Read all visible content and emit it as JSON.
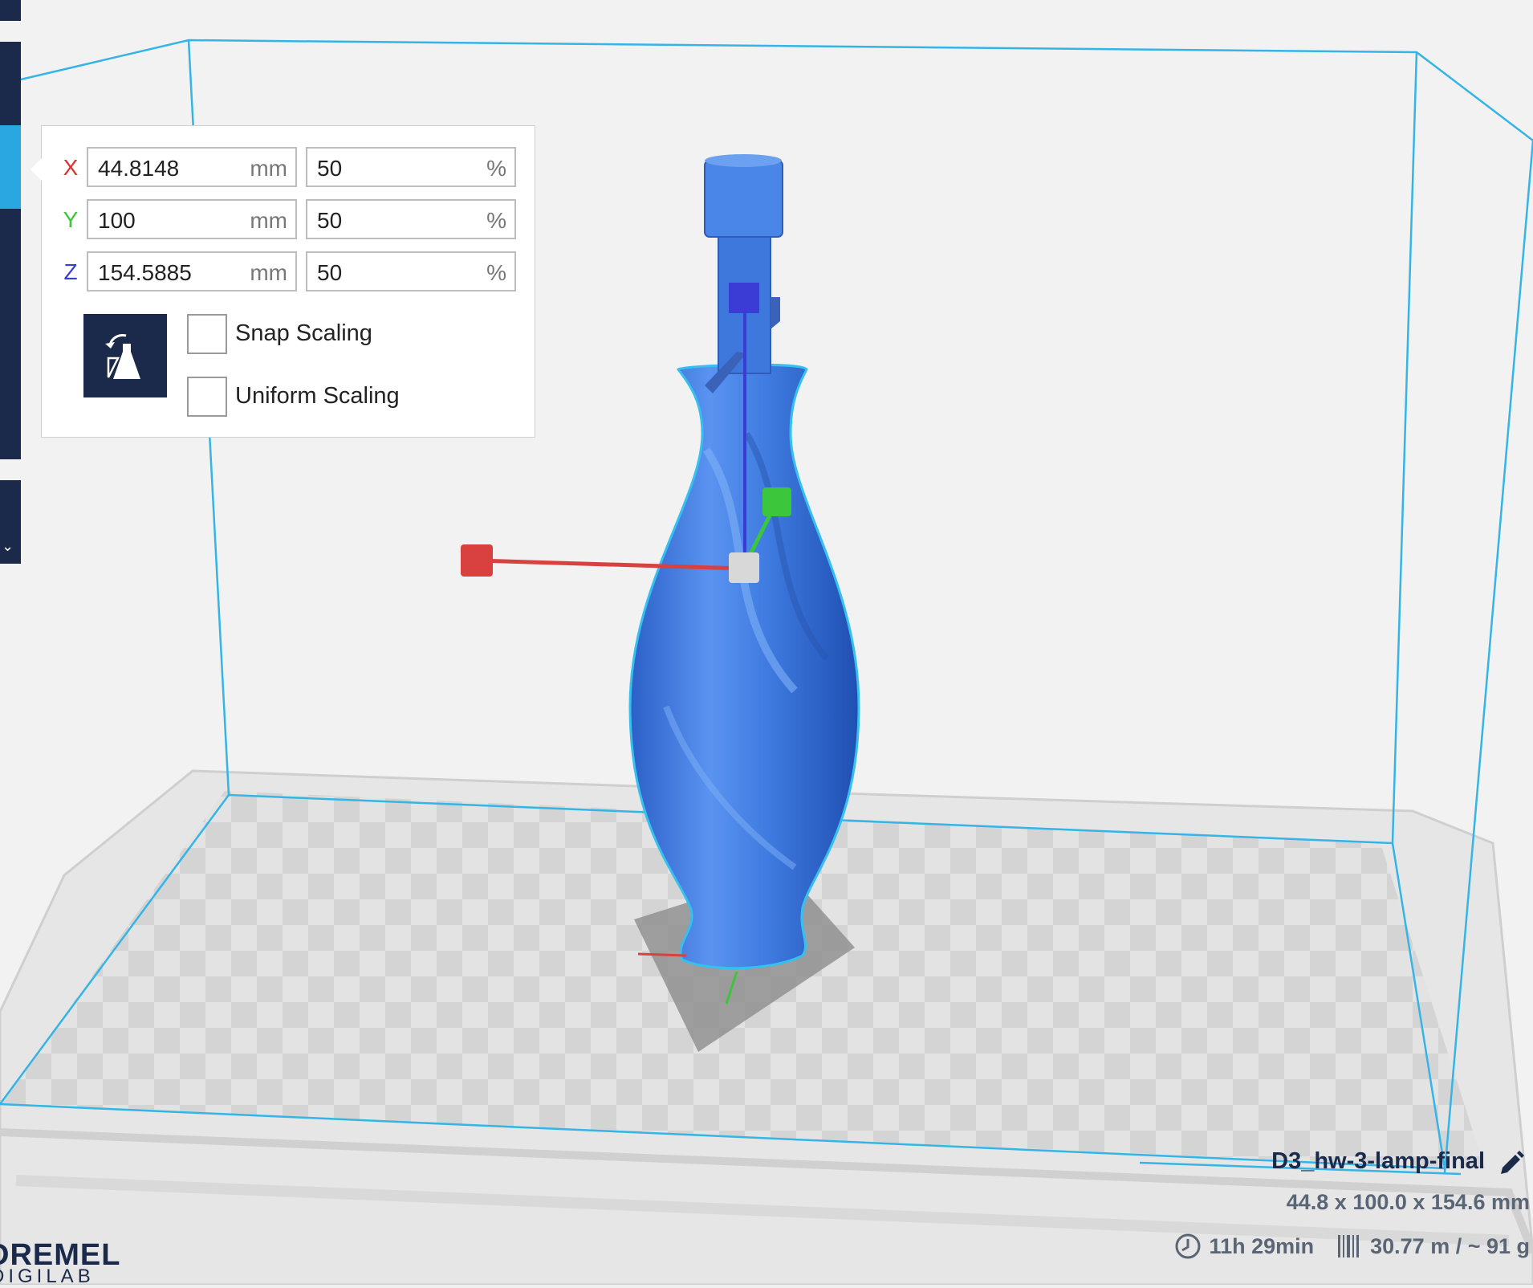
{
  "scale_tool": {
    "x": {
      "label": "X",
      "mm": "44.8148",
      "mm_unit": "mm",
      "percent": "50",
      "percent_unit": "%",
      "color": "#e03030"
    },
    "y": {
      "label": "Y",
      "mm": "100",
      "mm_unit": "mm",
      "percent": "50",
      "percent_unit": "%",
      "color": "#3cc63c"
    },
    "z": {
      "label": "Z",
      "mm": "154.5885",
      "mm_unit": "mm",
      "percent": "50",
      "percent_unit": "%",
      "color": "#3b3bd6"
    },
    "snap_scaling_label": "Snap Scaling",
    "snap_scaling_checked": false,
    "uniform_scaling_label": "Uniform Scaling",
    "uniform_scaling_checked": false,
    "reset_icon": "reset-scale-icon"
  },
  "model_info": {
    "name": "D3_hw-3-lamp-final",
    "dimensions": "44.8 x 100.0 x 154.6 mm",
    "print_time": "11h 29min",
    "material": "30.77 m / ~ 91 g"
  },
  "brand": {
    "line1": "DREMEL",
    "line2": "DIGILAB"
  },
  "colors": {
    "toolbar": "#1b2a4a",
    "toolbar_active": "#2aa6e0",
    "model": "#3a78e0",
    "build_volume_outline": "#35b4e6"
  }
}
